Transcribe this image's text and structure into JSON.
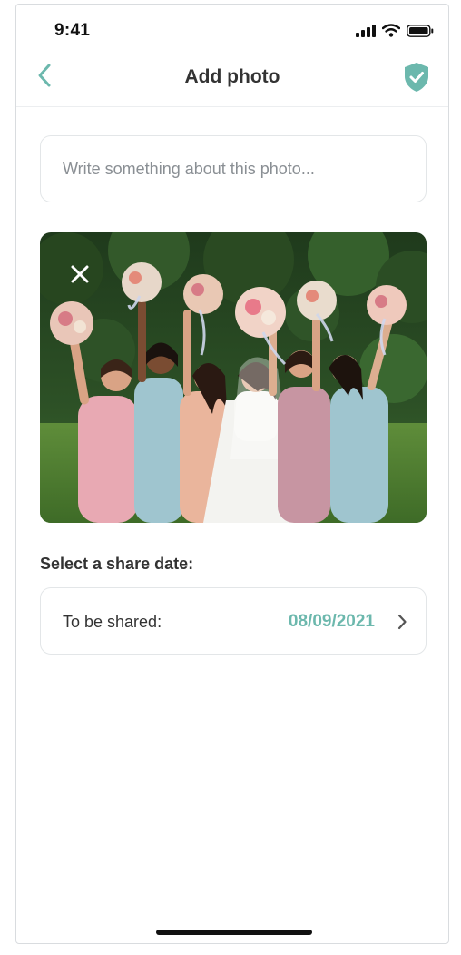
{
  "status_bar": {
    "time": "9:41",
    "icons": [
      "signal-icon",
      "wifi-icon",
      "battery-icon"
    ]
  },
  "header": {
    "title": "Add photo",
    "back_icon": "chevron-left-icon",
    "action_icon": "shield-check-icon"
  },
  "caption": {
    "placeholder": "Write something about this photo...",
    "value": ""
  },
  "photo": {
    "remove_icon": "close-icon"
  },
  "share_date": {
    "section_label": "Select a share date:",
    "label": "To be shared:",
    "value": "08/09/2021",
    "chevron_icon": "chevron-right-icon"
  },
  "colors": {
    "accent": "#6cb8ad",
    "text": "#333333",
    "placeholder": "#8a8f94",
    "border": "#e3e6e8"
  }
}
